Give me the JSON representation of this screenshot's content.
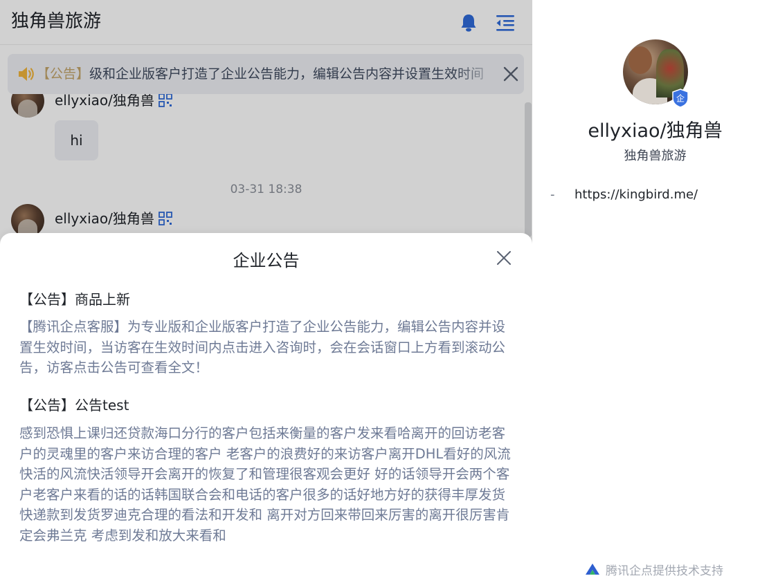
{
  "header": {
    "title": "独角兽旅游",
    "icons": [
      "bell-icon",
      "collapse-panel-icon"
    ]
  },
  "notice_bar": {
    "tag": "【公告】",
    "text": "级和企业版客户打造了企业公告能力，编辑公告内容并设置生效时间",
    "icons": [
      "speaker-icon",
      "close-icon"
    ]
  },
  "messages": {
    "top_sender": "ellyxiao/独角兽",
    "top_message": "hi",
    "timestamp": "03-31 18:38",
    "second_sender": "ellyxiao/独角兽"
  },
  "announcement_sheet": {
    "title": "企业公告",
    "items": [
      {
        "title": "【公告】商品上新",
        "body": "【腾讯企点客服】为专业版和企业版客户打造了企业公告能力，编辑公告内容并设置生效时间，当访客在生效时间内点击进入咨询时，会在会话窗口上方看到滚动公告，访客点击公告可查看全文！"
      },
      {
        "title": "【公告】公告test",
        "body": "感到恐惧上课归还贷款海口分行的客户包括来衡量的客户发来看哈离开的回访老客户的灵魂里的客户来访合理的客户 老客户的浪费好的来访客户离开DHL看好的风流快活的风流快活领导开会离开的恢复了和管理很客观会更好 好的话领导开会两个客户老客户来看的话的话韩国联合会和电话的客户很多的话好地方好的获得丰厚发货快递款到发货罗迪克合理的看法和开发和 离开对方回来带回来厉害的离开很厉害肯定会弗兰克 考虑到发和放大来看和"
      }
    ]
  },
  "profile": {
    "name": "ellyxiao/独角兽",
    "company": "独角兽旅游",
    "link_bullet": "-",
    "link": "https://kingbird.me/",
    "badge_label": "企",
    "powered_by": "腾讯企点提供技术支持"
  },
  "colors": {
    "accent_blue": "#2f6bd9",
    "notice_tag": "#c2a46a",
    "speaker": "#f0b43c",
    "notice_body": "#6e7a95"
  }
}
